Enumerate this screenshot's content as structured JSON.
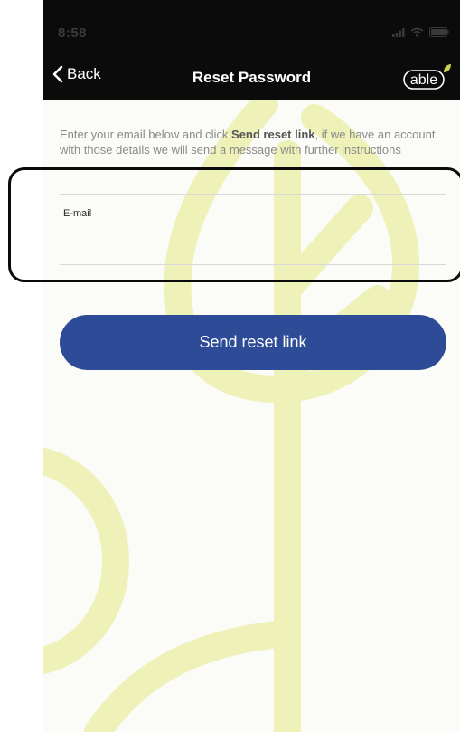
{
  "status_bar": {
    "time": "8:58"
  },
  "nav": {
    "back_label": "Back",
    "title": "Reset Password",
    "logo_text": "able"
  },
  "form": {
    "instructions_part1": "Enter your email below and click ",
    "instructions_bold": "Send reset link",
    "instructions_part2": ", if we have an account with those details we will send a message with further instructions",
    "email_label": "E-mail",
    "email_value": "",
    "submit_label": "Send reset link"
  },
  "colors": {
    "header_bg": "#0b0b0b",
    "button_bg": "#2e4b97",
    "watermark": "#eef2b8",
    "logo_leaf": "#c9d24a"
  }
}
